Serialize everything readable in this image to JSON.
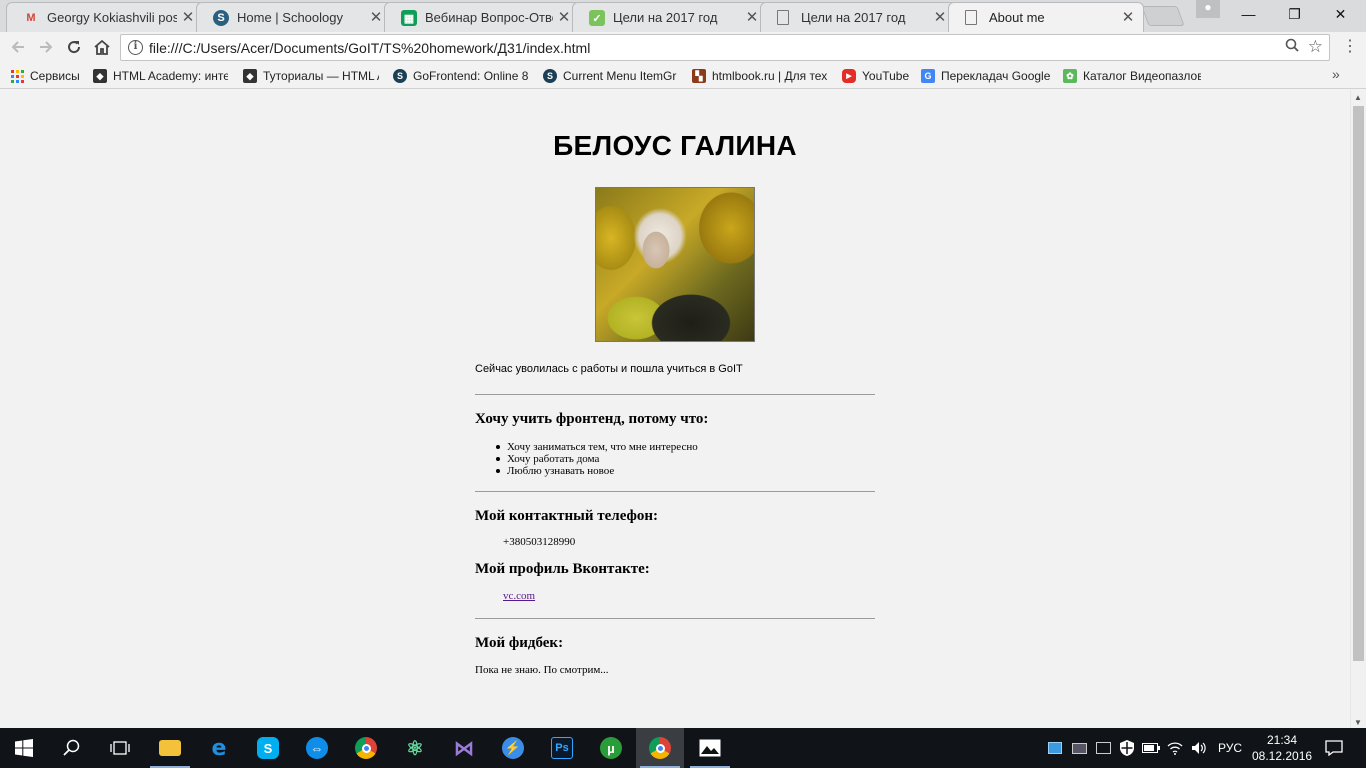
{
  "browser": {
    "tabs": [
      {
        "title": "Georgy Kokiashvili poste",
        "icon": "gmail-icon",
        "active": false
      },
      {
        "title": "Home | Schoology",
        "icon": "schoology-icon",
        "active": false
      },
      {
        "title": "Вебинар Вопрос-Ответ",
        "icon": "sheets-icon",
        "active": false
      },
      {
        "title": "Цели на 2017 год",
        "icon": "sheets-icon",
        "active": false
      },
      {
        "title": "Цели на 2017 год",
        "icon": "document-icon",
        "active": false
      },
      {
        "title": "About me",
        "icon": "document-icon",
        "active": true
      }
    ],
    "tab_close_glyph": "✕",
    "address": {
      "url": "file:///C:/Users/Acer/Documents/GoIT/TS%20homework/Д31/index.html"
    },
    "bookmarks": [
      {
        "label": "Сервисы",
        "icon": "apps-icon"
      },
      {
        "label": "HTML Academy: инте",
        "icon": "html-academy-icon"
      },
      {
        "label": "Туториалы — HTML A",
        "icon": "html-academy-icon"
      },
      {
        "label": "GoFrontend: Online 8",
        "icon": "schoology-icon"
      },
      {
        "label": "Current Menu ItemGr",
        "icon": "schoology-icon"
      },
      {
        "label": "htmlbook.ru | Для тех",
        "icon": "htmlbook-icon"
      },
      {
        "label": "YouTube",
        "icon": "youtube-icon"
      },
      {
        "label": "Перекладач Google",
        "icon": "translate-icon"
      },
      {
        "label": "Каталог Видеопазлов",
        "icon": "puzzle-icon"
      }
    ],
    "bookmarks_more": "»"
  },
  "page": {
    "title": "БЕЛОУС ГАЛИНА",
    "intro": "Сейчас уволилась с работы и пошла учиться в GoIT",
    "why_heading": "Хочу учить фронтенд, потому что:",
    "reasons": [
      "Хочу заниматься тем, что мне интересно",
      "Хочу работать дома",
      "Люблю узнавать новое"
    ],
    "phone_heading": "Мой контактный телефон:",
    "phone": "+380503128990",
    "vk_heading": "Мой профиль Вконтакте:",
    "vk_link": "vc.com",
    "feedback_heading": "Мой фидбек:",
    "feedback_text": "Пока не знаю. По смотрим..."
  },
  "taskbar": {
    "language": "РУС",
    "time": "21:34",
    "date": "08.12.2016",
    "apps": [
      "windows-start-icon",
      "search-icon",
      "task-view-icon",
      "file-explorer-icon",
      "edge-icon",
      "skype-icon",
      "teamviewer-icon",
      "chrome-icon",
      "atom-icon",
      "visual-studio-icon",
      "bolt-app-icon",
      "photoshop-icon",
      "utorrent-icon",
      "chrome-icon",
      "photos-icon"
    ]
  },
  "colors": {
    "link": "#551a8b",
    "page_background": "#f2f2f3",
    "taskbar": "#101317"
  }
}
